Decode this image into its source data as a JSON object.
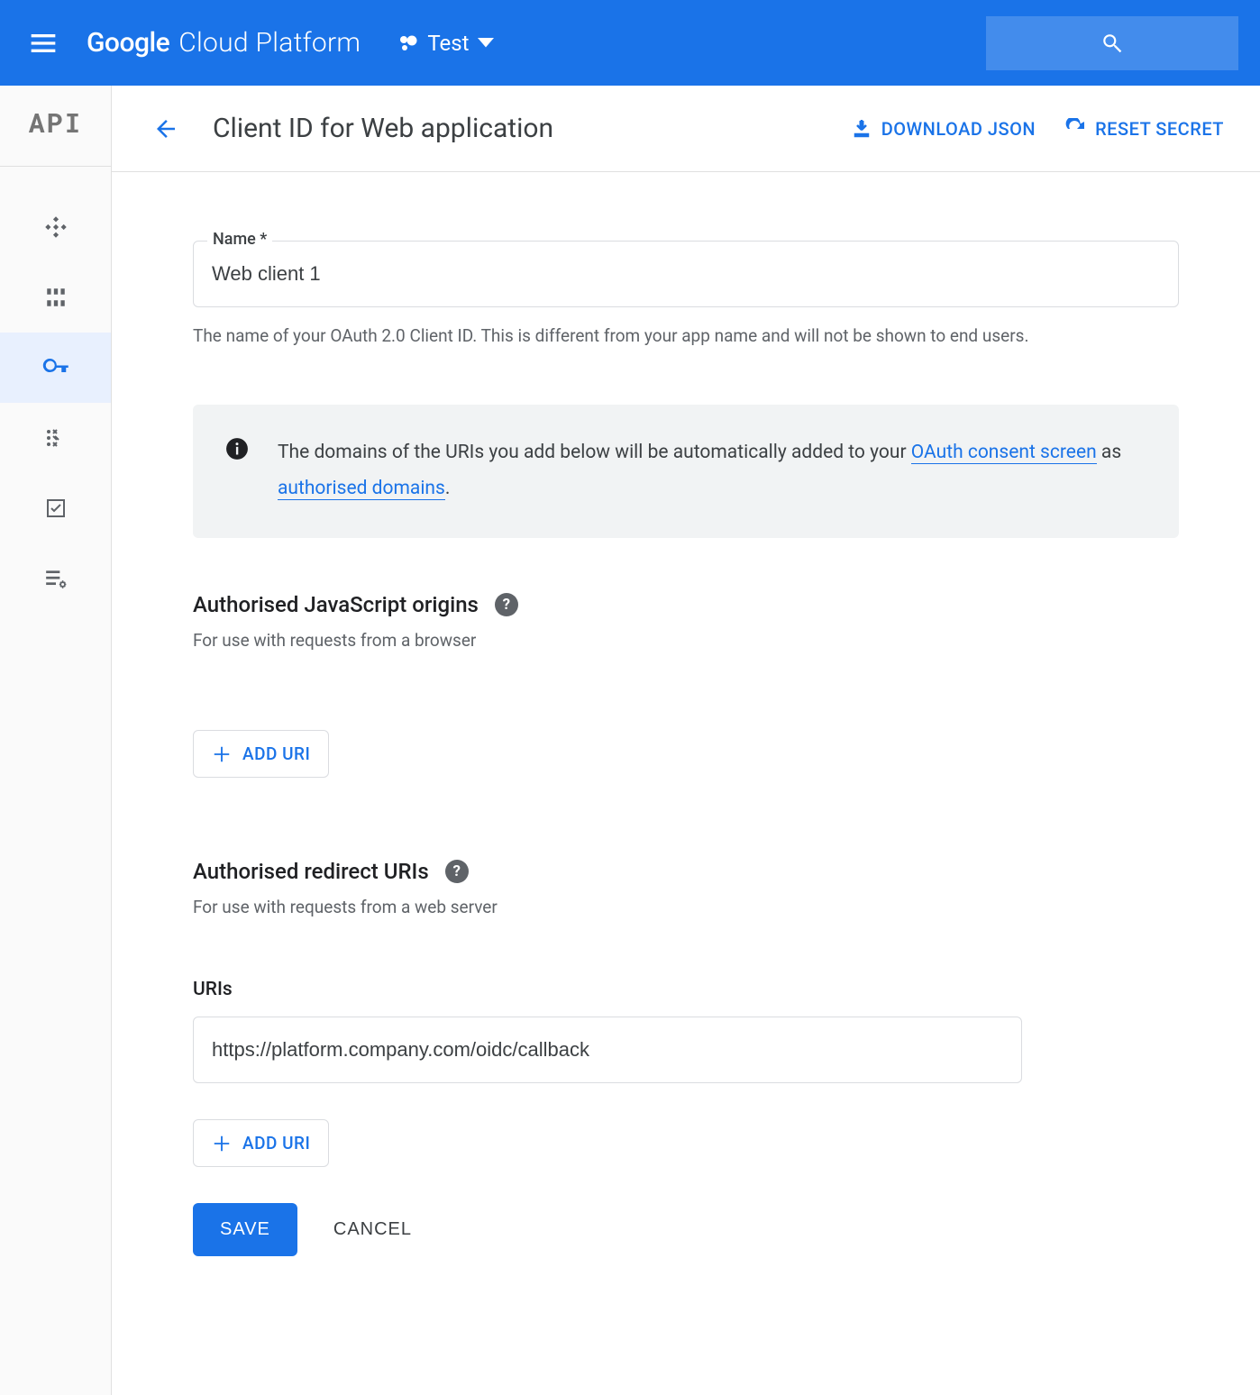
{
  "header": {
    "brand_google": "Google",
    "brand_rest": "Cloud Platform",
    "project_label": "Test"
  },
  "sidebar": {
    "api_label": "API"
  },
  "subheader": {
    "title": "Client ID for Web application",
    "download_label": "DOWNLOAD JSON",
    "reset_label": "RESET SECRET"
  },
  "form": {
    "name_label": "Name *",
    "name_value": "Web client 1",
    "name_helper": "The name of your OAuth 2.0 Client ID. This is different from your app name and will not be shown to end users.",
    "info_text_pre": "The domains of the URIs you add below will be automatically added to your ",
    "info_link1": "OAuth consent screen",
    "info_text_mid": " as ",
    "info_link2": "authorised domains",
    "info_text_post": ".",
    "js_origins_title": "Authorised JavaScript origins",
    "js_origins_sub": "For use with requests from a browser",
    "add_uri_label": "ADD URI",
    "redirect_title": "Authorised redirect URIs",
    "redirect_sub": "For use with requests from a web server",
    "uris_label": "URIs",
    "uri_value": "https://platform.company.com/oidc/callback",
    "save_label": "SAVE",
    "cancel_label": "CANCEL"
  }
}
